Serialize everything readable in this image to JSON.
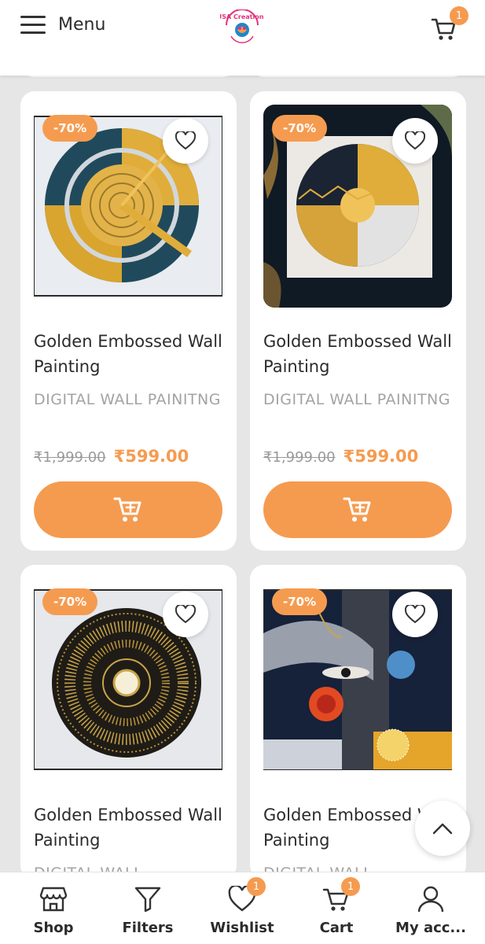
{
  "header": {
    "menu_label": "Menu",
    "logo_text": "USA Creations",
    "cart_count": "1"
  },
  "products": [
    {
      "discount": "-70%",
      "title": "Golden Embossed Wall Painting",
      "category": "DIGITAL WALL PAINITNG",
      "old_price": "₹1,999.00",
      "price": "₹599.00"
    },
    {
      "discount": "-70%",
      "title": "Golden Embossed Wall Painting",
      "category": "DIGITAL WALL PAINITNG",
      "old_price": "₹1,999.00",
      "price": "₹599.00"
    },
    {
      "discount": "-70%",
      "title": "Golden Embossed Wall Painting",
      "category": "DIGITAL WALL",
      "old_price": "",
      "price": ""
    },
    {
      "discount": "-70%",
      "title": "Golden Embossed Wall Painting",
      "category": "DIGITAL WALL",
      "old_price": "",
      "price": ""
    }
  ],
  "bottom_nav": {
    "items": [
      {
        "label": "Shop",
        "icon": "shop-icon"
      },
      {
        "label": "Filters",
        "icon": "filter-icon"
      },
      {
        "label": "Wishlist",
        "icon": "heart-icon",
        "badge": "1"
      },
      {
        "label": "Cart",
        "icon": "cart-icon",
        "badge": "1"
      },
      {
        "label": "My acc...",
        "icon": "user-icon"
      }
    ]
  },
  "colors": {
    "accent": "#f59b50",
    "background": "#e6e6e6",
    "text": "#2b2b2b",
    "muted": "#a3a3a3"
  }
}
